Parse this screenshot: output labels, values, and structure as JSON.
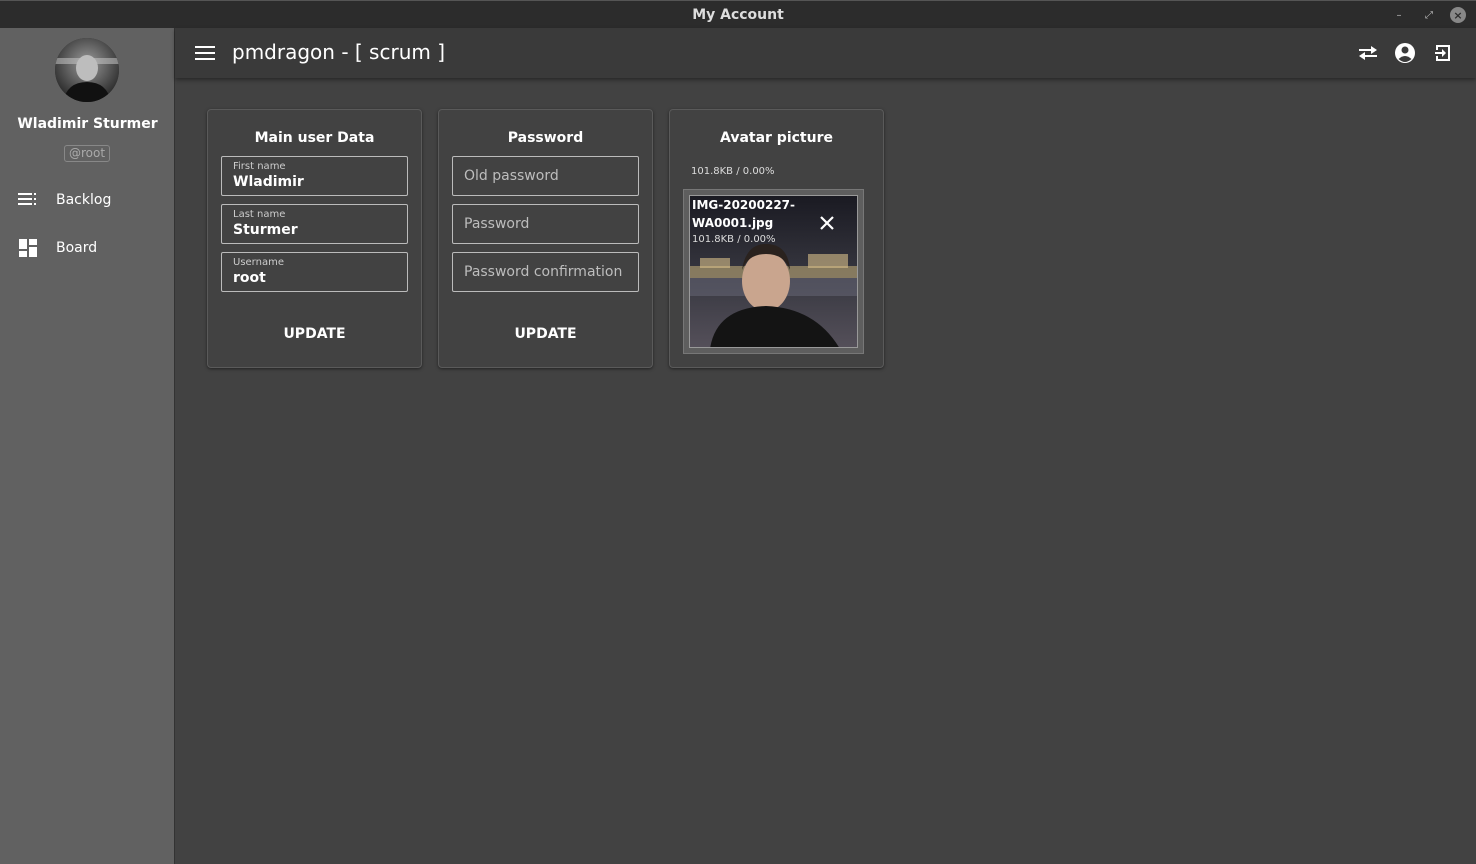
{
  "window": {
    "title": "My Account"
  },
  "sidebar": {
    "user_name": "Wladimir Sturmer",
    "user_handle": "@root",
    "items": [
      {
        "label": "Backlog",
        "icon": "list-icon"
      },
      {
        "label": "Board",
        "icon": "dashboard-icon"
      }
    ]
  },
  "appbar": {
    "title": "pmdragon - [ scrum ]",
    "icons": [
      "swap-icon",
      "account-circle-icon",
      "logout-icon"
    ]
  },
  "main_user_data": {
    "title": "Main user Data",
    "first_name_label": "First name",
    "first_name_value": "Wladimir",
    "last_name_label": "Last name",
    "last_name_value": "Sturmer",
    "username_label": "Username",
    "username_value": "root",
    "update_label": "UPDATE"
  },
  "password": {
    "title": "Password",
    "old_password_placeholder": "Old password",
    "password_placeholder": "Password",
    "confirmation_placeholder": "Password confirmation",
    "update_label": "UPDATE"
  },
  "avatar": {
    "title": "Avatar picture",
    "file_size": "101.8KB / 0.00%",
    "file_name": "IMG-20200227-WA0001.jpg",
    "file_size_overlay": "101.8KB / 0.00%"
  },
  "colors": {
    "sidebar_bg": "#616161",
    "content_bg": "#424242",
    "appbar_bg": "#3a3a3a",
    "titlebar_bg": "#2c2c2c"
  }
}
